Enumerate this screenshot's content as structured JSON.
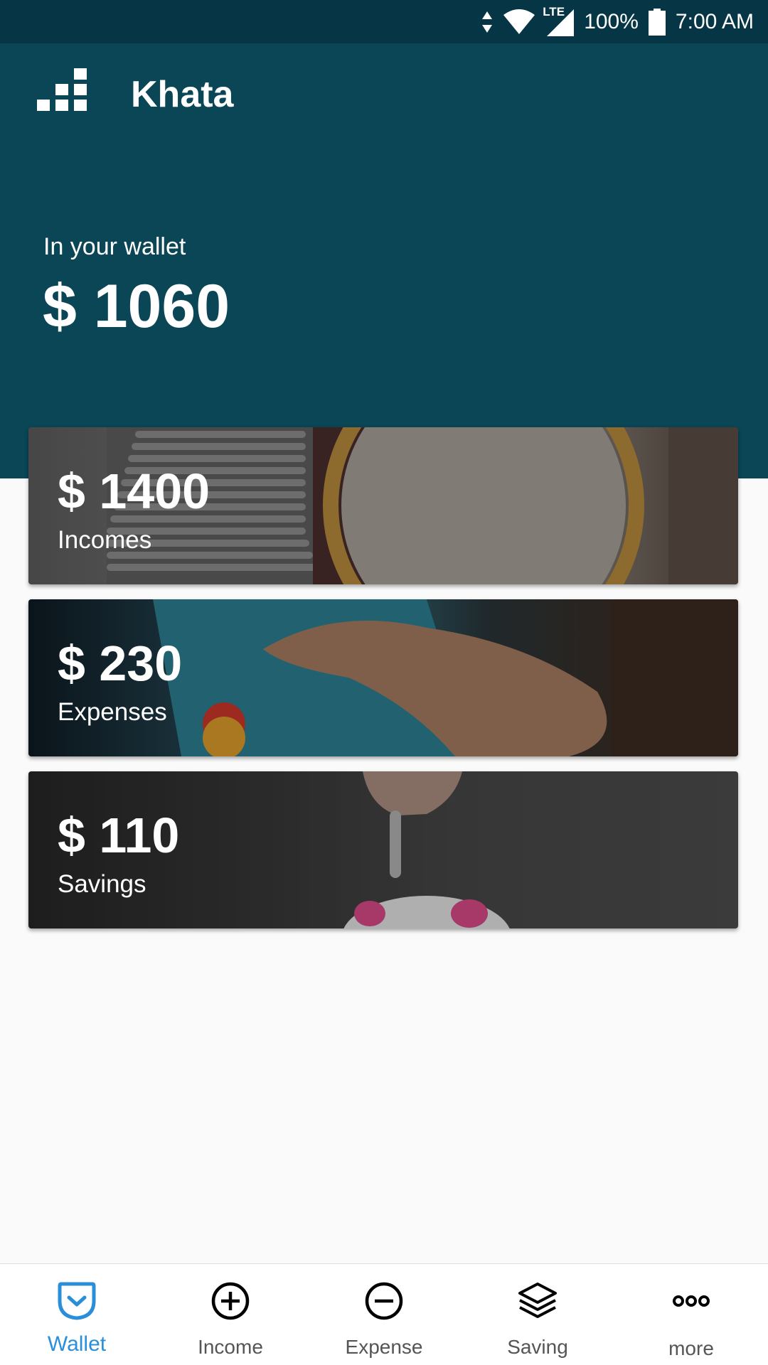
{
  "status_bar": {
    "battery": "100%",
    "time": "7:00 AM",
    "network": "LTE"
  },
  "header": {
    "app_title": "Khata",
    "wallet_label": "In your wallet",
    "wallet_amount": "$ 1060"
  },
  "cards": [
    {
      "amount": "$ 1400",
      "label": "Incomes"
    },
    {
      "amount": "$ 230",
      "label": "Expenses"
    },
    {
      "amount": "$ 110",
      "label": "Savings"
    }
  ],
  "bottom_nav": {
    "items": [
      {
        "label": "Wallet",
        "icon": "wallet-icon",
        "active": true
      },
      {
        "label": "Income",
        "icon": "plus-circle-icon",
        "active": false
      },
      {
        "label": "Expense",
        "icon": "minus-circle-icon",
        "active": false
      },
      {
        "label": "Saving",
        "icon": "layers-icon",
        "active": false
      },
      {
        "label": "more",
        "icon": "more-dots-icon",
        "active": false
      }
    ]
  },
  "colors": {
    "header_bg": "#0a4656",
    "status_bg": "#063645",
    "active_nav": "#2a8fd8",
    "inactive_nav": "#555555"
  }
}
